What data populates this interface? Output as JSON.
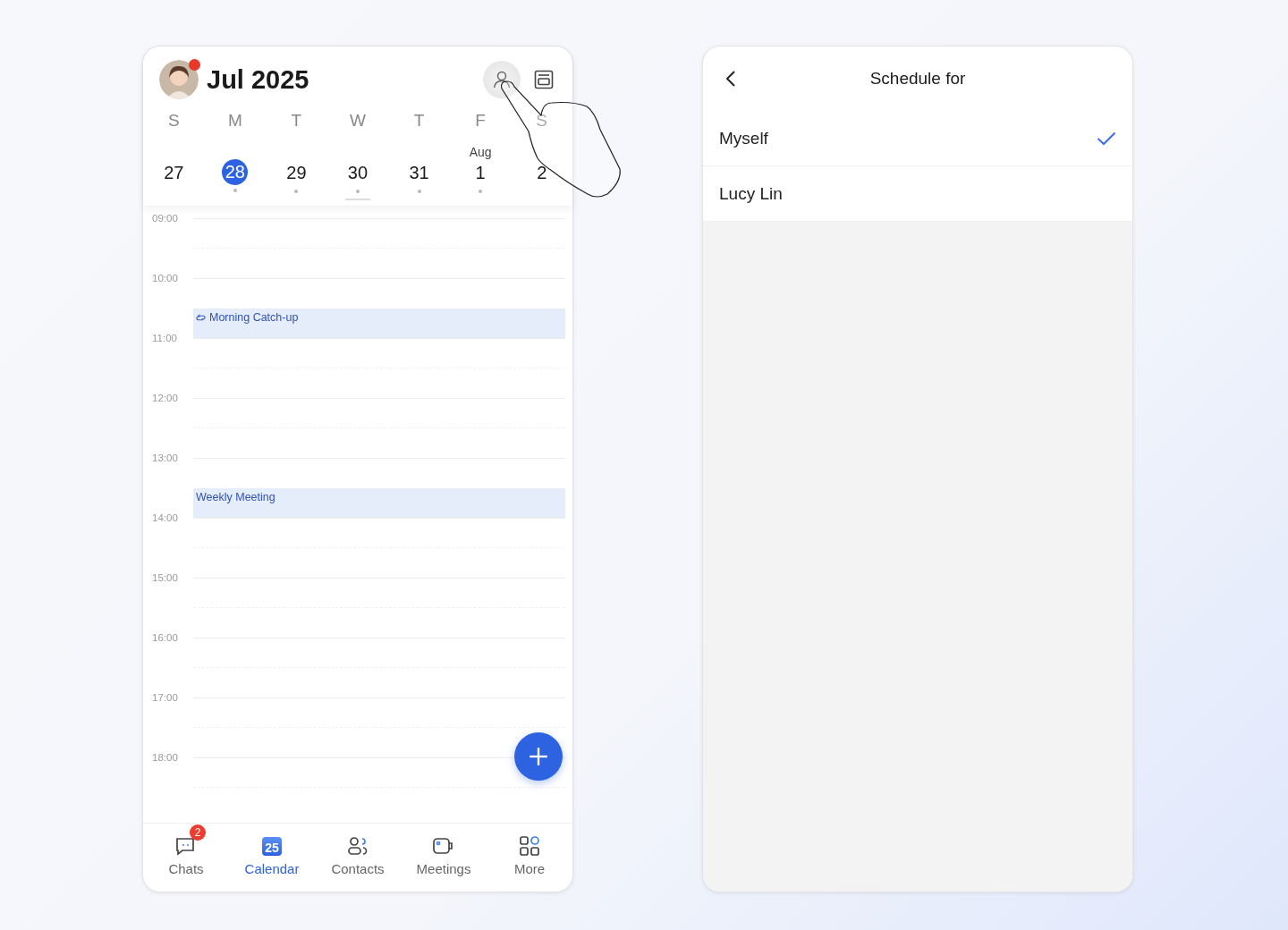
{
  "calendar": {
    "title": "Jul 2025",
    "avatar_badge": true,
    "days": [
      {
        "weekday": "S",
        "date": "27",
        "selected": false,
        "has_events": false
      },
      {
        "weekday": "M",
        "date": "28",
        "selected": true,
        "has_events": true
      },
      {
        "weekday": "T",
        "date": "29",
        "selected": false,
        "has_events": true
      },
      {
        "weekday": "W",
        "date": "30",
        "selected": false,
        "has_events": true
      },
      {
        "weekday": "T",
        "date": "31",
        "selected": false,
        "has_events": true
      },
      {
        "weekday": "F",
        "date": "1",
        "month": "Aug",
        "selected": false,
        "has_events": true
      },
      {
        "weekday": "S",
        "date": "2",
        "selected": false,
        "has_events": false
      }
    ],
    "hours": [
      {
        "label": "09:00"
      },
      {
        "label": "10:00",
        "event": {
          "title": "Morning Catch-up",
          "recurring": true
        }
      },
      {
        "label": "11:00"
      },
      {
        "label": "12:00"
      },
      {
        "label": "13:00",
        "event": {
          "title": "Weekly Meeting",
          "recurring": false
        }
      },
      {
        "label": "14:00"
      },
      {
        "label": "15:00"
      },
      {
        "label": "16:00"
      },
      {
        "label": "17:00"
      },
      {
        "label": "18:00"
      }
    ],
    "nav": [
      {
        "kind": "chats",
        "label": "Chats",
        "badge": "2",
        "selected": false
      },
      {
        "kind": "calendar",
        "label": "Calendar",
        "icon_text": "25",
        "selected": true
      },
      {
        "kind": "contacts",
        "label": "Contacts",
        "selected": false
      },
      {
        "kind": "meetings",
        "label": "Meetings",
        "selected": false
      },
      {
        "kind": "more",
        "label": "More",
        "selected": false
      }
    ]
  },
  "schedule_for": {
    "title": "Schedule for",
    "options": [
      {
        "label": "Myself",
        "selected": true
      },
      {
        "label": "Lucy Lin",
        "selected": false
      }
    ]
  }
}
